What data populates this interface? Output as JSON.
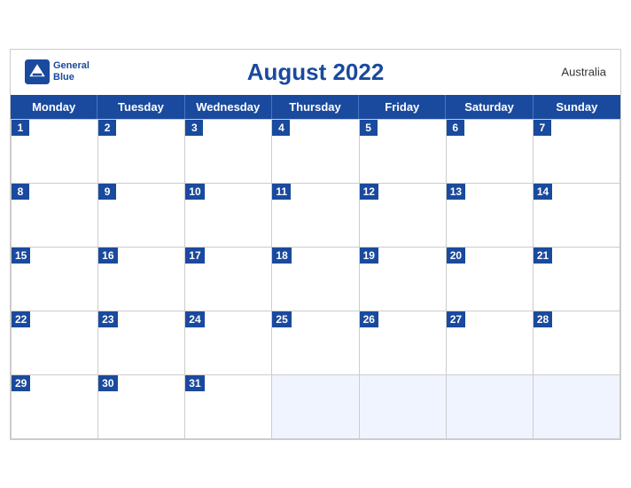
{
  "header": {
    "title": "August 2022",
    "country": "Australia",
    "logo_line1": "General",
    "logo_line2": "Blue"
  },
  "days_of_week": [
    "Monday",
    "Tuesday",
    "Wednesday",
    "Thursday",
    "Friday",
    "Saturday",
    "Sunday"
  ],
  "weeks": [
    [
      1,
      2,
      3,
      4,
      5,
      6,
      7
    ],
    [
      8,
      9,
      10,
      11,
      12,
      13,
      14
    ],
    [
      15,
      16,
      17,
      18,
      19,
      20,
      21
    ],
    [
      22,
      23,
      24,
      25,
      26,
      27,
      28
    ],
    [
      29,
      30,
      31,
      null,
      null,
      null,
      null
    ]
  ],
  "colors": {
    "primary_blue": "#1a4a9e",
    "light_blue": "#4a72c4",
    "empty_bg": "#e8eef8"
  }
}
